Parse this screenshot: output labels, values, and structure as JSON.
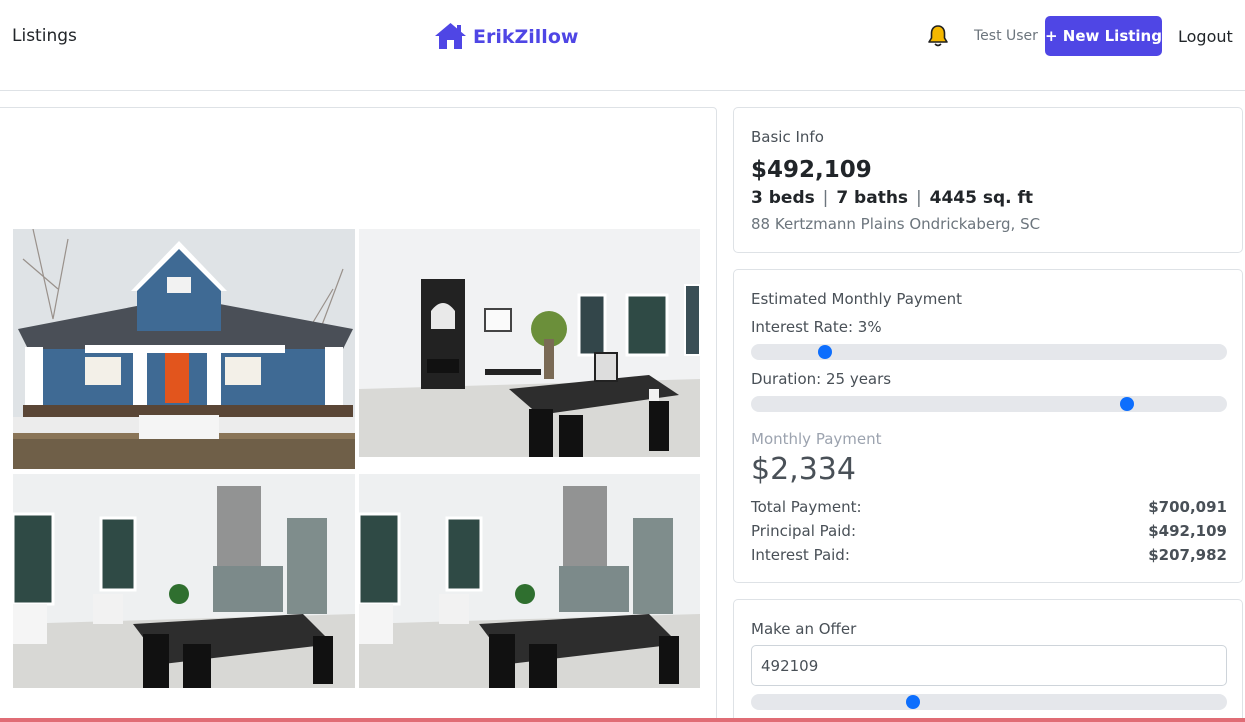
{
  "nav": {
    "listings_label": "Listings",
    "brand": "ErikZillow",
    "user_name": "Test User",
    "new_listing_label": "+ New Listing",
    "logout_label": "Logout"
  },
  "basic_info": {
    "title": "Basic Info",
    "price": "$492,109",
    "beds": "3 beds",
    "baths": "7 baths",
    "sqft": "4445 sq. ft",
    "separator": "|",
    "address": "88 Kertzmann Plains Ondrickaberg, SC"
  },
  "payment": {
    "title": "Estimated Monthly Payment",
    "interest_label": "Interest Rate: 3%",
    "interest_fraction": 0.155,
    "duration_label": "Duration: 25 years",
    "duration_fraction": 0.79,
    "monthly_label": "Monthly Payment",
    "monthly_value": "$2,334",
    "rows": [
      {
        "label": "Total Payment:",
        "value": "$700,091"
      },
      {
        "label": "Principal Paid:",
        "value": "$492,109"
      },
      {
        "label": "Interest Paid:",
        "value": "$207,982"
      }
    ]
  },
  "offer": {
    "title": "Make an Offer",
    "value": "492109",
    "slider_fraction": 0.34
  },
  "colors": {
    "brand": "#4f46e5",
    "slider_thumb": "#0d6efd",
    "bell": "#f5b800"
  },
  "icons": [
    "house-icon",
    "bell-icon"
  ]
}
